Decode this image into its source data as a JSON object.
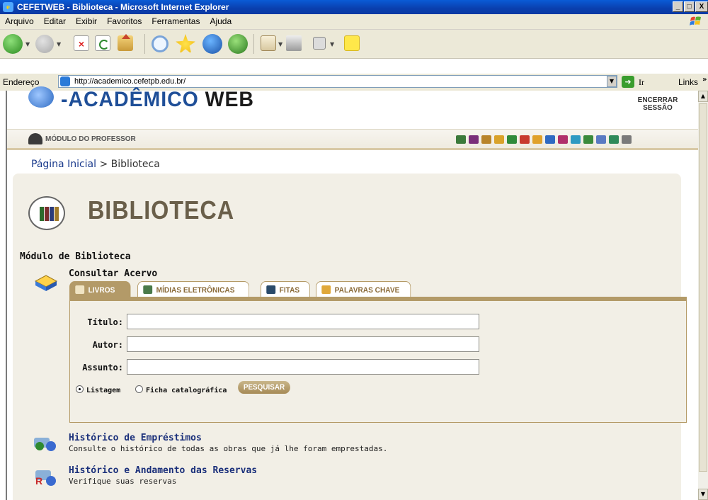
{
  "window": {
    "title": "CEFETWEB - Biblioteca - Microsoft Internet Explorer",
    "controls": {
      "minimize": "_",
      "maximize": "□",
      "close": "X"
    }
  },
  "menubar": [
    "Arquivo",
    "Editar",
    "Exibir",
    "Favoritos",
    "Ferramentas",
    "Ajuda"
  ],
  "toolbar": {
    "buttons": [
      "back-icon",
      "forward-icon",
      "stop-icon",
      "refresh-icon",
      "home-icon",
      "search-icon",
      "favorites-icon",
      "media-icon",
      "history-icon",
      "mail-icon",
      "print-icon",
      "edit-icon",
      "notes-icon"
    ]
  },
  "address": {
    "label": "Endereço",
    "url": "http://academico.cefetpb.edu.br/",
    "go_label": "Ir",
    "links_label": "Links",
    "links_chevron": "»"
  },
  "header": {
    "logo_text": "-ACADÊMICO",
    "logo_text2": "WEB",
    "logout": [
      "ENCERRAR",
      "SESSÃO"
    ]
  },
  "modulebar": {
    "label": "MÓDULO DO PROFESSOR",
    "icon_colors": [
      "#3b7a3b",
      "#7a2f7a",
      "#b8842a",
      "#d9a22a",
      "#2f8a3a",
      "#c83b2f",
      "#e0a12a",
      "#2f6ac2",
      "#b02f6a",
      "#2f9ac2",
      "#3a8a3a",
      "#5a7ac2",
      "#2f8a5a",
      "#7a7a7a"
    ]
  },
  "breadcrumb": {
    "home": "Página Inicial",
    "separator": " > ",
    "current": "Biblioteca"
  },
  "page_title": "BIBLIOTECA",
  "module_title": "Módulo de Biblioteca",
  "consultar": {
    "title": "Consultar Acervo",
    "tabs": [
      {
        "label": "LIVROS",
        "active": true
      },
      {
        "label": "MÍDIAS ELETRÔNICAS",
        "active": false
      },
      {
        "label": "FITAS",
        "active": false
      },
      {
        "label": "PALAVRAS CHAVE",
        "active": false
      }
    ],
    "fields": [
      {
        "label": "Título:",
        "value": ""
      },
      {
        "label": "Autor:",
        "value": ""
      },
      {
        "label": "Assunto:",
        "value": ""
      }
    ],
    "radios": [
      {
        "label": "Listagem",
        "checked": true
      },
      {
        "label": "Ficha catalográfica",
        "checked": false
      }
    ],
    "search_button": "PESQUISAR"
  },
  "links": [
    {
      "title": "Histórico de Empréstimos",
      "desc": "Consulte o histórico de todas as obras que já lhe foram emprestadas."
    },
    {
      "title": "Histórico e Andamento das Reservas",
      "desc": "Verifique suas reservas"
    }
  ]
}
